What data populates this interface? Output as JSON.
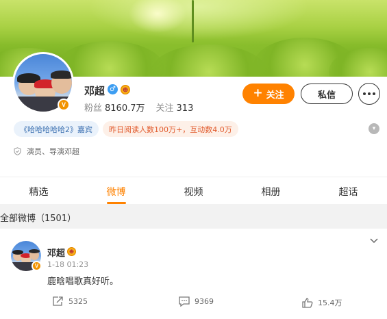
{
  "profile": {
    "name": "邓超",
    "fans_label": "粉丝",
    "fans_value": "8160.7万",
    "follow_label": "关注",
    "follow_value": "313",
    "verified_badge": "V",
    "gender_icon": "male-icon"
  },
  "buttons": {
    "follow": "关注",
    "message": "私信"
  },
  "tags": {
    "show": "《哈哈哈哈哈2》嘉宾",
    "stats": "昨日阅读人数100万+，互动数4.0万"
  },
  "description": "演员、导演邓超",
  "tabs": [
    {
      "label": "精选"
    },
    {
      "label": "微博"
    },
    {
      "label": "视频"
    },
    {
      "label": "相册"
    },
    {
      "label": "超话"
    }
  ],
  "active_tab": "微博",
  "section_title": "全部微博（1501）",
  "post": {
    "author": "邓超",
    "time": "1-18 01:23",
    "text": "鹿晗唱歌真好听。",
    "reposts": "5325",
    "comments": "9369",
    "likes": "15.4万"
  },
  "colors": {
    "accent": "#ff8200",
    "verified": "#f29300",
    "tag_blue_text": "#3a6fb0",
    "tag_orange_text": "#e15a2c"
  }
}
